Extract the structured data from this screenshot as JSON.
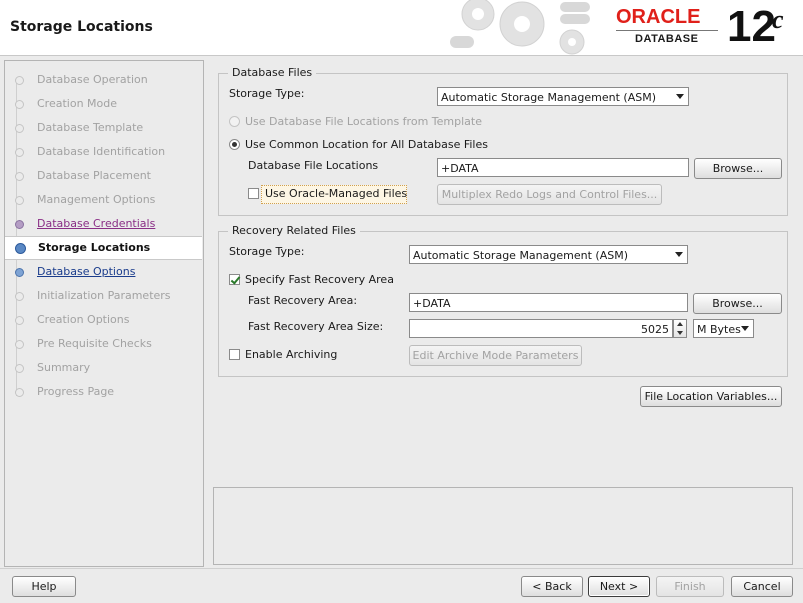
{
  "header": {
    "title": "Storage Locations",
    "brand": "ORACLE",
    "product": "DATABASE",
    "version": "12",
    "version_suffix": "c",
    "brand_color": "#e0201a"
  },
  "nav": {
    "items": [
      {
        "label": "Database Operation",
        "state": "done"
      },
      {
        "label": "Creation Mode",
        "state": "done"
      },
      {
        "label": "Database Template",
        "state": "done"
      },
      {
        "label": "Database Identification",
        "state": "done"
      },
      {
        "label": "Database Placement",
        "state": "done"
      },
      {
        "label": "Management Options",
        "state": "done"
      },
      {
        "label": "Database Credentials",
        "state": "visited"
      },
      {
        "label": "Storage Locations",
        "state": "current"
      },
      {
        "label": "Database Options",
        "state": "next"
      },
      {
        "label": "Initialization Parameters",
        "state": "pending"
      },
      {
        "label": "Creation Options",
        "state": "pending"
      },
      {
        "label": "Pre Requisite Checks",
        "state": "pending"
      },
      {
        "label": "Summary",
        "state": "pending"
      },
      {
        "label": "Progress Page",
        "state": "pending"
      }
    ]
  },
  "database_files": {
    "group_title": "Database Files",
    "storage_type_label": "Storage Type:",
    "storage_type_value": "Automatic Storage Management (ASM)",
    "radio_template_label": "Use Database File Locations from Template",
    "radio_common_label": "Use Common Location for All Database Files",
    "file_locations_label": "Database File Locations",
    "file_locations_value": "+DATA",
    "browse_label": "Browse...",
    "omf_label": "Use Oracle-Managed Files",
    "multiplex_label": "Multiplex Redo Logs and Control Files..."
  },
  "recovery_files": {
    "group_title": "Recovery Related Files",
    "storage_type_label": "Storage Type:",
    "storage_type_value": "Automatic Storage Management (ASM)",
    "fra_check_label": "Specify Fast Recovery Area",
    "fra_label": "Fast Recovery Area:",
    "fra_value": "+DATA",
    "browse_label": "Browse...",
    "fra_size_label": "Fast Recovery Area Size:",
    "fra_size_value": "5025",
    "fra_unit_value": "M Bytes",
    "archiving_label": "Enable Archiving",
    "archive_params_label": "Edit Archive Mode Parameters"
  },
  "file_location_variables_label": "File Location Variables...",
  "footer": {
    "help_label": "Help",
    "back_label": "< Back",
    "next_label": "Next >",
    "finish_label": "Finish",
    "cancel_label": "Cancel"
  }
}
